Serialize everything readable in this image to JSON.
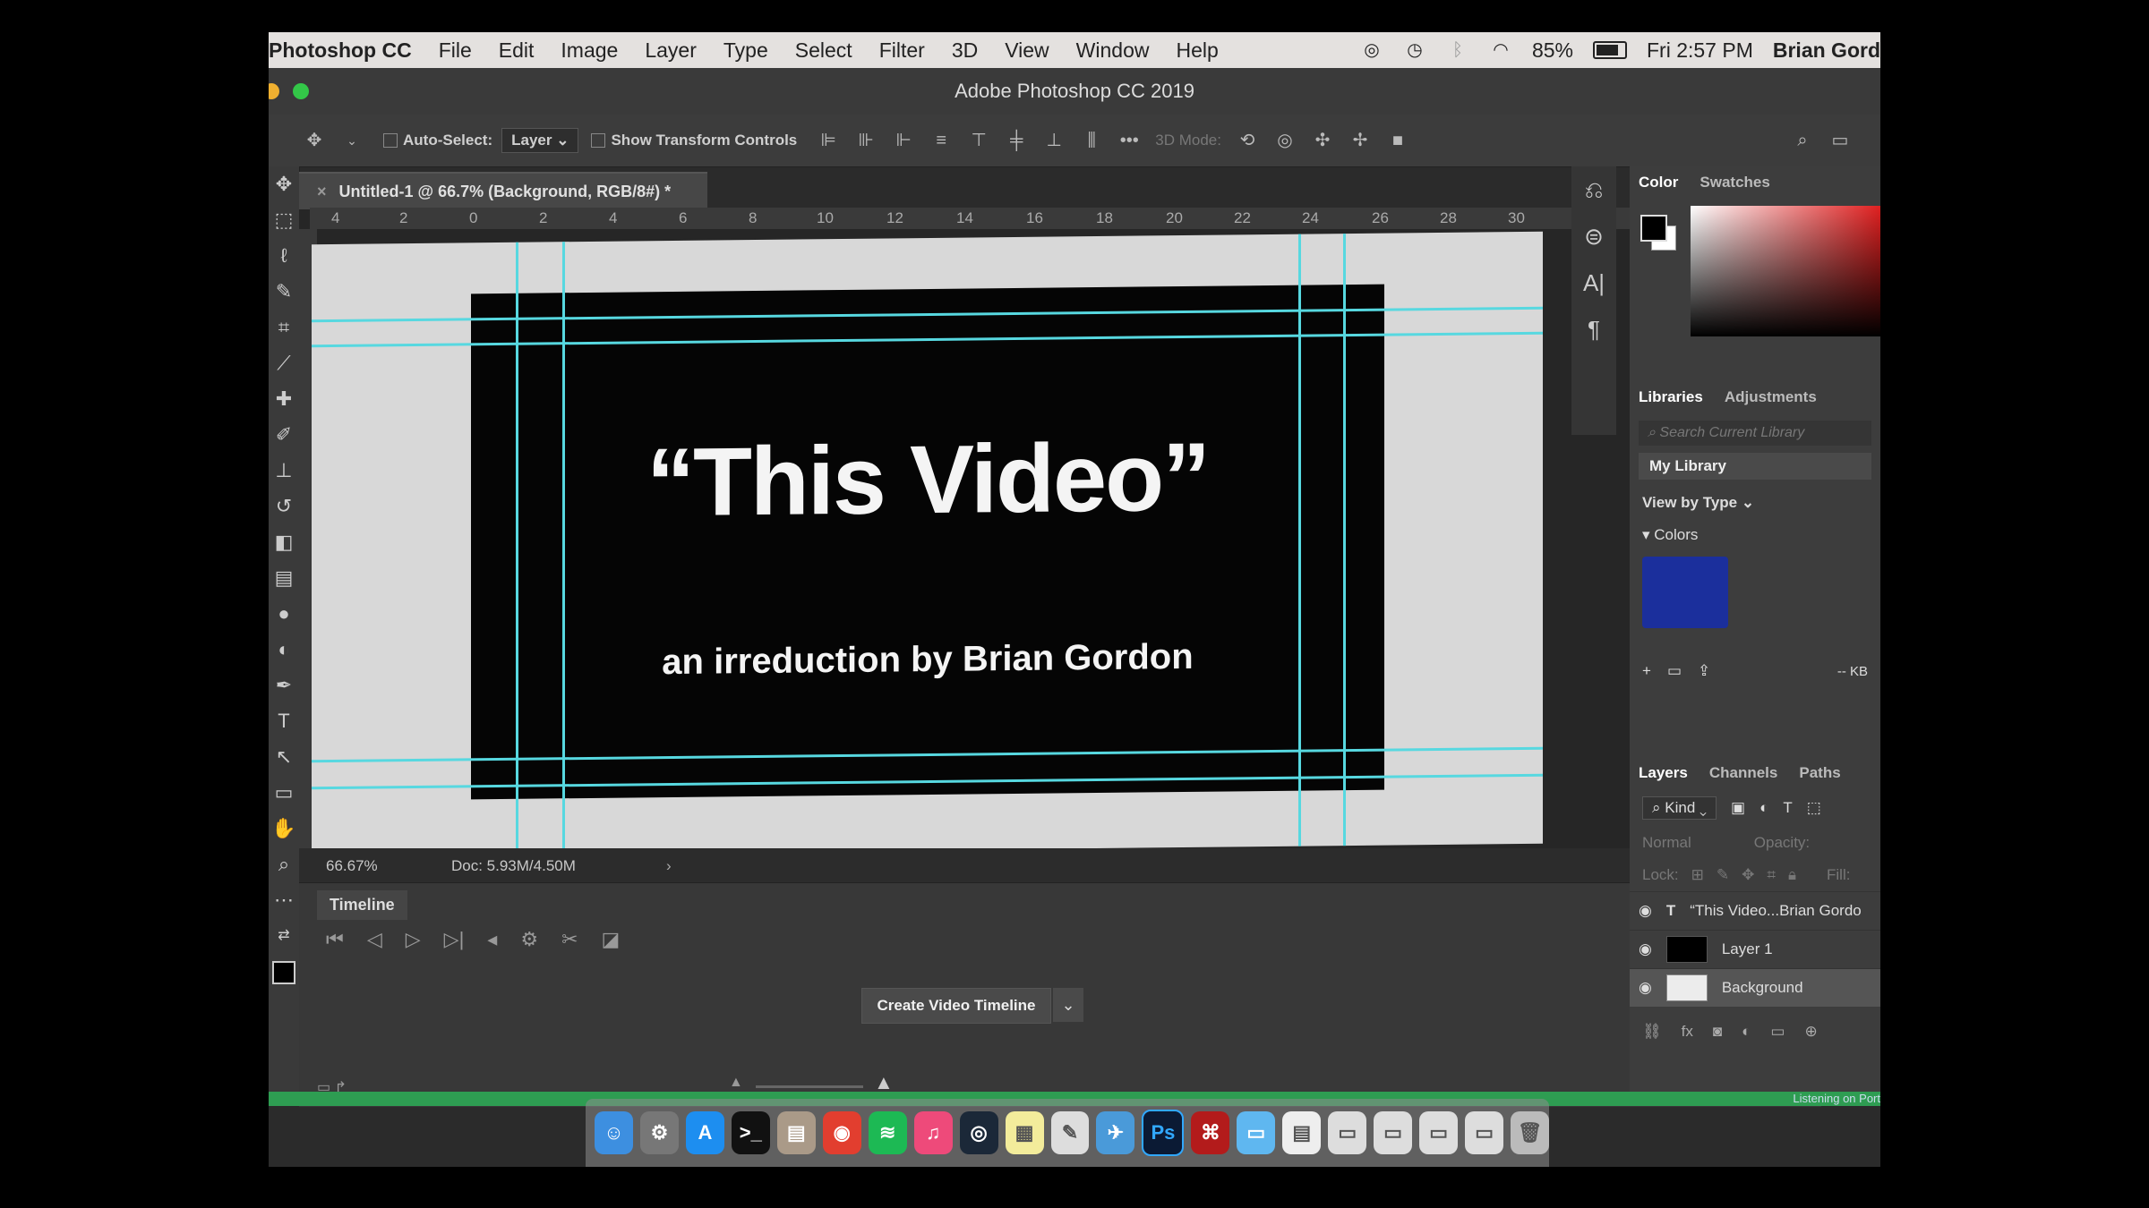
{
  "menubar": {
    "app_name": "Photoshop CC",
    "menus": [
      "File",
      "Edit",
      "Image",
      "Layer",
      "Type",
      "Select",
      "Filter",
      "3D",
      "View",
      "Window",
      "Help"
    ],
    "battery": "85%",
    "clock": "Fri 2:57 PM",
    "user": "Brian Gord"
  },
  "window": {
    "title": "Adobe Photoshop CC 2019"
  },
  "options": {
    "auto_select_label": "Auto-Select:",
    "layer_select": "Layer",
    "transform_label": "Show Transform Controls",
    "mode_label": "3D Mode:"
  },
  "document": {
    "tab_title": "Untitled-1 @ 66.7% (Background, RGB/8#) *",
    "ruler_ticks": [
      "4",
      "2",
      "0",
      "2",
      "4",
      "6",
      "8",
      "10",
      "12",
      "14",
      "16",
      "18",
      "20",
      "22",
      "24",
      "26",
      "28",
      "30"
    ],
    "headline": "“This Video”",
    "subline": "an irreduction by Brian Gordon",
    "zoom": "66.67%",
    "doc_size": "Doc: 5.93M/4.50M"
  },
  "timeline": {
    "tab": "Timeline",
    "create_button": "Create Video Timeline"
  },
  "color_panel": {
    "tabs": [
      "Color",
      "Swatches"
    ]
  },
  "libraries_panel": {
    "tabs": [
      "Libraries",
      "Adjustments"
    ],
    "search_placeholder": "Search Current Library",
    "library_name": "My Library",
    "view_by": "View by Type",
    "colors_label": "Colors",
    "swatch_color": "#1b2f9c",
    "size_label": "-- KB"
  },
  "layers_panel": {
    "tabs": [
      "Layers",
      "Channels",
      "Paths"
    ],
    "kind_label": "Kind",
    "blend_mode": "Normal",
    "opacity_label": "Opacity:",
    "lock_label": "Lock:",
    "fill_label": "Fill:",
    "layers": [
      {
        "name": "“This Video...Brian Gordo",
        "type": "text"
      },
      {
        "name": "Layer 1",
        "type": "fill-black"
      },
      {
        "name": "Background",
        "type": "fill-white"
      }
    ]
  },
  "statusbar_right": "Listening on Port"
}
